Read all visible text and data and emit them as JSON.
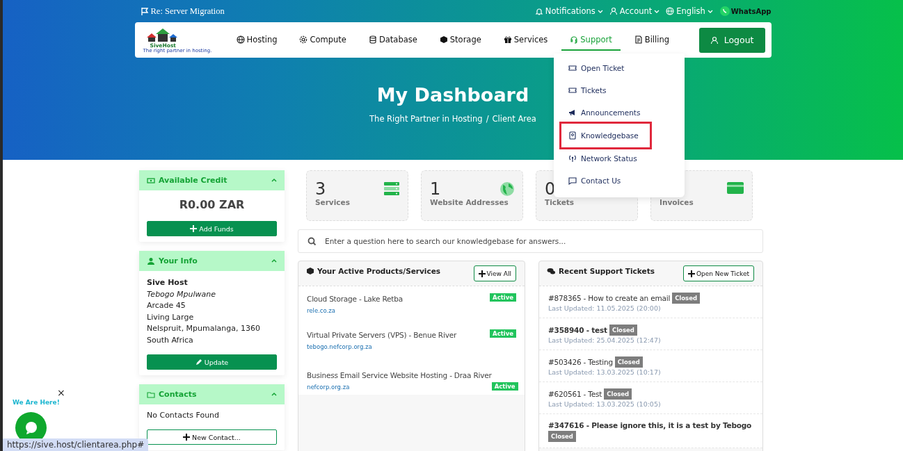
{
  "topbar": {
    "title": "Re: Server Migration",
    "links": [
      {
        "label": "Notifications"
      },
      {
        "label": "Account"
      },
      {
        "label": "English"
      }
    ],
    "whatsapp": "WhatsApp"
  },
  "logo": {
    "name": "SiveHost",
    "tagline": "The right partner in hosting."
  },
  "nav": [
    {
      "label": "Hosting",
      "selected": false
    },
    {
      "label": "Compute",
      "selected": false
    },
    {
      "label": "Database",
      "selected": false
    },
    {
      "label": "Storage",
      "selected": false
    },
    {
      "label": "Services",
      "selected": false
    },
    {
      "label": "Support",
      "selected": true
    },
    {
      "label": "Billing",
      "selected": false
    }
  ],
  "logout": "Logout",
  "dropdown": [
    {
      "label": "Open Ticket",
      "selected": false
    },
    {
      "label": "Tickets",
      "selected": false
    },
    {
      "label": "Announcements",
      "selected": false
    },
    {
      "label": "Knowledgebase",
      "selected": true
    },
    {
      "label": "Network Status",
      "selected": false
    },
    {
      "label": "Contact Us",
      "selected": false
    }
  ],
  "hero": {
    "title": "My Dashboard",
    "breadcrumb": [
      "The Right Partner in Hosting",
      "/",
      "Client Area"
    ]
  },
  "credit": {
    "title": "Available Credit",
    "amount": "R0.00 ZAR",
    "button": "Add Funds"
  },
  "info": {
    "title": "Your Info",
    "company": "Sive Host",
    "name": "Tebogo Mpulwane",
    "lines": [
      "Arcade 45",
      "Living Large",
      "Nelspruit, Mpumalanga, 1360",
      "South Africa"
    ],
    "button": "Update"
  },
  "contacts": {
    "title": "Contacts",
    "empty": "No Contacts Found",
    "button": "New Contact..."
  },
  "stats": [
    {
      "value": "3",
      "label": "Services"
    },
    {
      "value": "1",
      "label": "Website Addresses"
    },
    {
      "value": "0",
      "label": "Tickets"
    },
    {
      "label": "Invoices"
    }
  ],
  "search": {
    "placeholder": "Enter a question here to search our knowledgebase for answers..."
  },
  "products": {
    "title": "Your Active Products/Services",
    "button": "View All",
    "items": [
      {
        "name": "Cloud Storage - Lake Retba",
        "domain": "rele.co.za",
        "status": "Active"
      },
      {
        "name": "Virtual Private Servers (VPS) - Benue River",
        "domain": "tebogo.nefcorp.org.za",
        "status": "Active"
      },
      {
        "name": "Business Email Service Website Hosting - Draa River",
        "domain": "nefcorp.org.za",
        "status": "Active"
      }
    ]
  },
  "tickets": {
    "title": "Recent Support Tickets",
    "button": "Open New Ticket",
    "items": [
      {
        "subject": "#878365 - How to create an email",
        "status": "Closed",
        "updated": "Last Updated: 11.05.2025 (20:00)",
        "unread": false
      },
      {
        "subject": "#358940 - test",
        "status": "Closed",
        "updated": "Last Updated: 25.04.2025 (12:47)",
        "unread": true
      },
      {
        "subject": "#503426 - Testing",
        "status": "Closed",
        "updated": "Last Updated: 13.03.2025 (10:17)",
        "unread": false
      },
      {
        "subject": "#620561 - Test",
        "status": "Closed",
        "updated": "Last Updated: 13.03.2025 (10:05)",
        "unread": false
      },
      {
        "subject": "#347616 - Please ignore this, it is a test by Tebogo",
        "status": "Closed",
        "unread": true
      }
    ]
  },
  "chat": {
    "label": "We Are Here!",
    "close": "×"
  },
  "status_url": "https://sive.host/clientarea.php#"
}
